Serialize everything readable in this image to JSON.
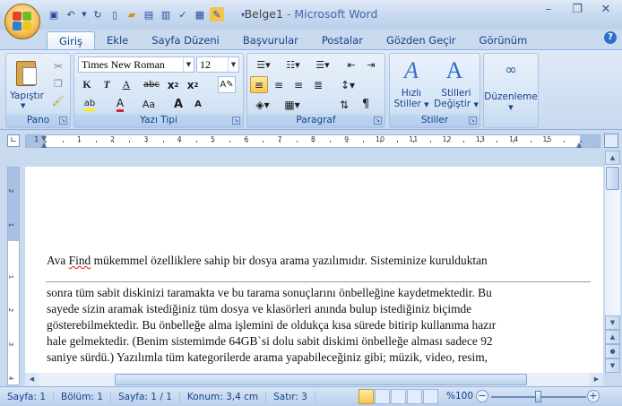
{
  "window": {
    "doc_name": "Belge1",
    "separator": " - ",
    "app_name": "Microsoft Word"
  },
  "quick_access": [
    "save-icon",
    "undo-icon",
    "redo-icon",
    "new-icon",
    "open-icon",
    "print-preview-icon",
    "print-icon",
    "spelling-icon",
    "format-painter-icon",
    "email-icon"
  ],
  "tabs": [
    "Giriş",
    "Ekle",
    "Sayfa Düzeni",
    "Başvurular",
    "Postalar",
    "Gözden Geçir",
    "Görünüm"
  ],
  "active_tab": "Giriş",
  "ribbon": {
    "clipboard": {
      "label": "Pano",
      "paste": "Yapıştır"
    },
    "font": {
      "label": "Yazı Tipi",
      "font_name": "Times New Roman",
      "font_size": "12",
      "bold": "K",
      "italic": "T",
      "underline": "A",
      "strike": "abc",
      "subscript": "x",
      "superscript": "x",
      "change_case": "Aa",
      "grow": "A",
      "shrink": "A"
    },
    "paragraph": {
      "label": "Paragraf"
    },
    "styles": {
      "label": "Stiller",
      "quick_styles_1": "Hızlı",
      "quick_styles_2": "Stiller",
      "change_styles_1": "Stilleri",
      "change_styles_2": "Değiştir"
    },
    "editing": {
      "label": "Düzenleme"
    }
  },
  "ruler": {
    "ticks": [
      "2",
      "1",
      "1",
      "2",
      "3",
      "4",
      "5",
      "6",
      "7",
      "8",
      "9",
      "10",
      "11",
      "12",
      "13",
      "14",
      "15"
    ],
    "vticks": [
      "2",
      "1",
      "1",
      "2",
      "3",
      "4"
    ]
  },
  "document": {
    "header_line": "Ava Find mükemmel özelliklere sahip bir dosya arama yazılımıdır. Sisteminize kurulduktan",
    "header_parts": {
      "before": "Ava ",
      "word": "Find",
      "after": " mükemmel  özelliklere  sahip bir dosya arama yazılımıdır.  Sisteminize kurulduktan"
    },
    "lines": [
      "sonra tüm sabit diskinizi taramakta ve bu tarama sonuçlarını önbelleğine kaydetmektedir. Bu",
      "sayede sizin aramak istediğiniz tüm dosya ve klasörleri  anında bulup istediğiniz biçimde",
      "gösterebilmektedir. Bu önbelleğe alma işlemini  de oldukça kısa sürede bitirip kullanıma  hazır",
      "hale gelmektedir. (Benim sistemimde 64GB`si dolu sabit diskimi önbelleğe alması sadece 92",
      "saniye sürdü.) Yazılımla tüm kategorilerde arama yapabileceğiniz  gibi; müzik, video, resim,"
    ]
  },
  "status": {
    "page": "Sayfa: 1",
    "section": "Bölüm: 1",
    "page_of": "Sayfa: 1 / 1",
    "position": "Konum: 3,4 cm",
    "line": "Satır: 3",
    "zoom": "%100",
    "zoom_level": 0.5
  }
}
